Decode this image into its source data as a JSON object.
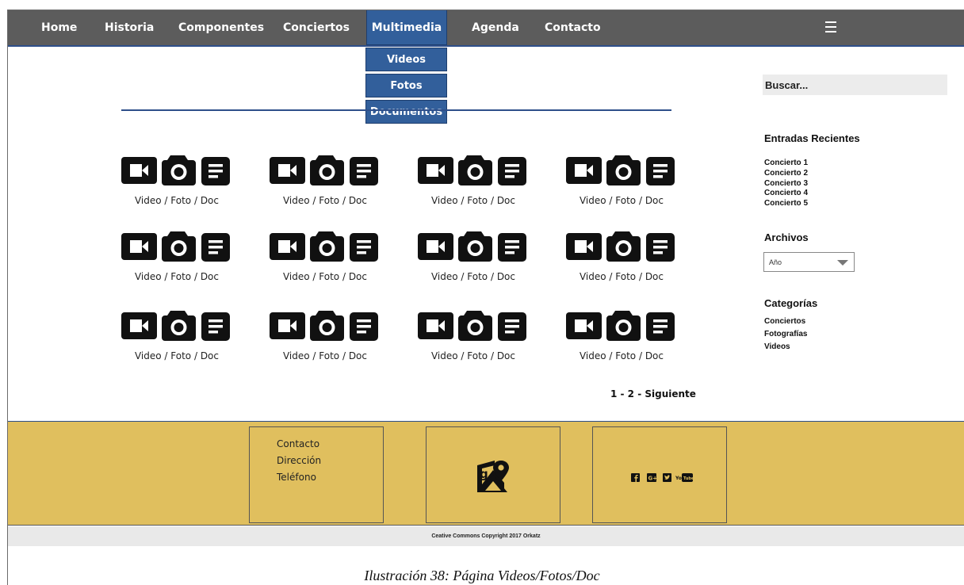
{
  "nav": {
    "items": [
      {
        "label": "Home"
      },
      {
        "label": "Historia"
      },
      {
        "label": "Componentes"
      },
      {
        "label": "Conciertos"
      },
      {
        "label": "Multimedia"
      },
      {
        "label": "Agenda"
      },
      {
        "label": "Contacto"
      }
    ],
    "active": "Multimedia",
    "accent_color": "#325f9b",
    "bar_color": "#5c5c5c"
  },
  "dropdown": {
    "items": [
      {
        "label": "Videos"
      },
      {
        "label": "Fotos"
      },
      {
        "label": "Documentos"
      }
    ]
  },
  "gallery": {
    "item_label": "Video / Foto / Doc",
    "rows": 3,
    "columns": 4,
    "icons": [
      "video-camera-icon",
      "camera-icon",
      "document-icon"
    ]
  },
  "pagination": {
    "label": "1 - 2 - Siguiente"
  },
  "sidebar": {
    "search_placeholder": "Buscar...",
    "recent": {
      "title": "Entradas Recientes",
      "items": [
        "Concierto 1",
        "Concierto 2",
        "Concierto 3",
        "Concierto 4",
        "Concierto 5"
      ]
    },
    "archives": {
      "title": "Archivos",
      "selected": "Año"
    },
    "categories": {
      "title": "Categorías",
      "items": [
        "Conciertos",
        "Fotografías",
        "Videos"
      ]
    }
  },
  "footer": {
    "background": "#e0bf5e",
    "contact": [
      "Contacto",
      "Dirección",
      "Teléfono"
    ],
    "map_icon": "google-maps-icon",
    "social": [
      "facebook-icon",
      "google-plus-icon",
      "twitter-icon",
      "youtube-icon"
    ],
    "social_youtube_text": "YouTube",
    "copyright": "Ceative Commons Copyright 2017 Orkatz"
  },
  "caption": "Ilustración 38: Página Videos/Fotos/Doc"
}
